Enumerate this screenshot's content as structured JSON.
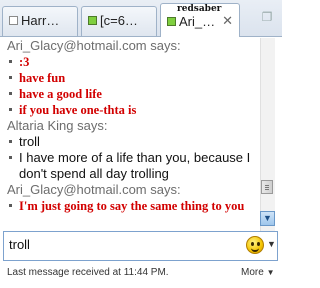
{
  "tabs": [
    {
      "label": "Harr…",
      "status": "offline",
      "active": false
    },
    {
      "label": "[c=6…",
      "status": "online",
      "active": false
    },
    {
      "label": "Ari_…",
      "status": "online",
      "active": true,
      "user_tag": "redsaber"
    }
  ],
  "messages": [
    {
      "type": "sender",
      "text": "Ari_Glacy@hotmail.com says:"
    },
    {
      "type": "red",
      "text": ":3"
    },
    {
      "type": "red",
      "text": "have fun"
    },
    {
      "type": "red",
      "text": "have a good life"
    },
    {
      "type": "red",
      "text": "if you have one-thta is"
    },
    {
      "type": "sender",
      "text": "Altaria King says:"
    },
    {
      "type": "plain",
      "text": "troll"
    },
    {
      "type": "plain",
      "text": "I have more of a life than you, because I don't spend all day trolling"
    },
    {
      "type": "sender",
      "text": "Ari_Glacy@hotmail.com says:"
    },
    {
      "type": "red",
      "text": "I'm just going to say the same thing to you"
    }
  ],
  "input": {
    "value": "troll"
  },
  "status_text": "Last message received at 11:44 PM.",
  "more_label": "More",
  "colors": {
    "accent_red": "#d20000",
    "sender_gray": "#6d6d6d"
  }
}
